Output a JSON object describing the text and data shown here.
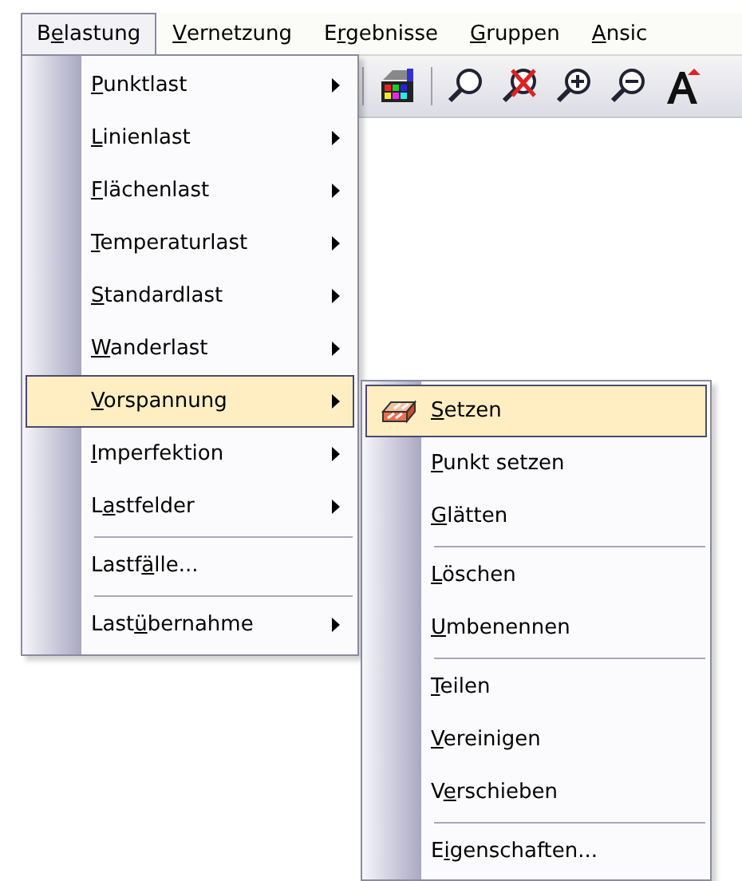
{
  "menubar": [
    {
      "label": {
        "before": "B",
        "key": "e",
        "after": "lastung"
      },
      "selected": true
    },
    {
      "label": {
        "key": "V",
        "after": "ernetzung"
      },
      "selected": false
    },
    {
      "label": {
        "before": "E",
        "key": "r",
        "after": "gebnisse"
      },
      "selected": false
    },
    {
      "label": {
        "key": "G",
        "after": "ruppen"
      },
      "selected": false
    },
    {
      "label": {
        "key": "A",
        "after": "nsic"
      },
      "selected": false
    }
  ],
  "menu": {
    "items": [
      {
        "label": {
          "key": "P",
          "after": "unktlast"
        },
        "submenu": true,
        "selected": false,
        "separator_before": false
      },
      {
        "label": {
          "key": "L",
          "after": "inienlast"
        },
        "submenu": true,
        "selected": false,
        "separator_before": false
      },
      {
        "label": {
          "key": "F",
          "after": "lächenlast"
        },
        "submenu": true,
        "selected": false,
        "separator_before": false
      },
      {
        "label": {
          "key": "T",
          "after": "emperaturlast"
        },
        "submenu": true,
        "selected": false,
        "separator_before": false
      },
      {
        "label": {
          "key": "S",
          "after": "tandardlast"
        },
        "submenu": true,
        "selected": false,
        "separator_before": false
      },
      {
        "label": {
          "key": "W",
          "after": "anderlast"
        },
        "submenu": true,
        "selected": false,
        "separator_before": false
      },
      {
        "label": {
          "key": "V",
          "after": "orspannung"
        },
        "submenu": true,
        "selected": true,
        "separator_before": false
      },
      {
        "label": {
          "key": "I",
          "after": "mperfektion"
        },
        "submenu": true,
        "selected": false,
        "separator_before": false
      },
      {
        "label": {
          "before": "L",
          "key": "a",
          "after": "stfelder"
        },
        "submenu": true,
        "selected": false,
        "separator_before": false
      },
      {
        "label": {
          "before": "Lastf",
          "key": "ä",
          "after": "lle..."
        },
        "submenu": false,
        "selected": false,
        "separator_before": true
      },
      {
        "label": {
          "before": "Last",
          "key": "ü",
          "after": "bernahme"
        },
        "submenu": true,
        "selected": false,
        "separator_before": true
      }
    ]
  },
  "submenu": {
    "items": [
      {
        "label": {
          "key": "S",
          "after": "etzen"
        },
        "icon": true,
        "selected": true,
        "separator_before": false
      },
      {
        "label": {
          "key": "P",
          "after": "unkt setzen"
        },
        "icon": false,
        "selected": false,
        "separator_before": false
      },
      {
        "label": {
          "key": "G",
          "after": "lätten"
        },
        "icon": false,
        "selected": false,
        "separator_before": false
      },
      {
        "label": {
          "key": "L",
          "after": "öschen"
        },
        "icon": false,
        "selected": false,
        "separator_before": true
      },
      {
        "label": {
          "key": "U",
          "after": "mbenennen"
        },
        "icon": false,
        "selected": false,
        "separator_before": false
      },
      {
        "label": {
          "key": "T",
          "after": "eilen"
        },
        "icon": false,
        "selected": false,
        "separator_before": true
      },
      {
        "label": {
          "key": "V",
          "after": "ereinigen"
        },
        "icon": false,
        "selected": false,
        "separator_before": false
      },
      {
        "label": {
          "before": "V",
          "key": "e",
          "after": "rschieben"
        },
        "icon": false,
        "selected": false,
        "separator_before": false
      },
      {
        "label": {
          "before": "E",
          "key": "i",
          "after": "genschaften..."
        },
        "icon": false,
        "selected": false,
        "separator_before": true
      }
    ]
  }
}
